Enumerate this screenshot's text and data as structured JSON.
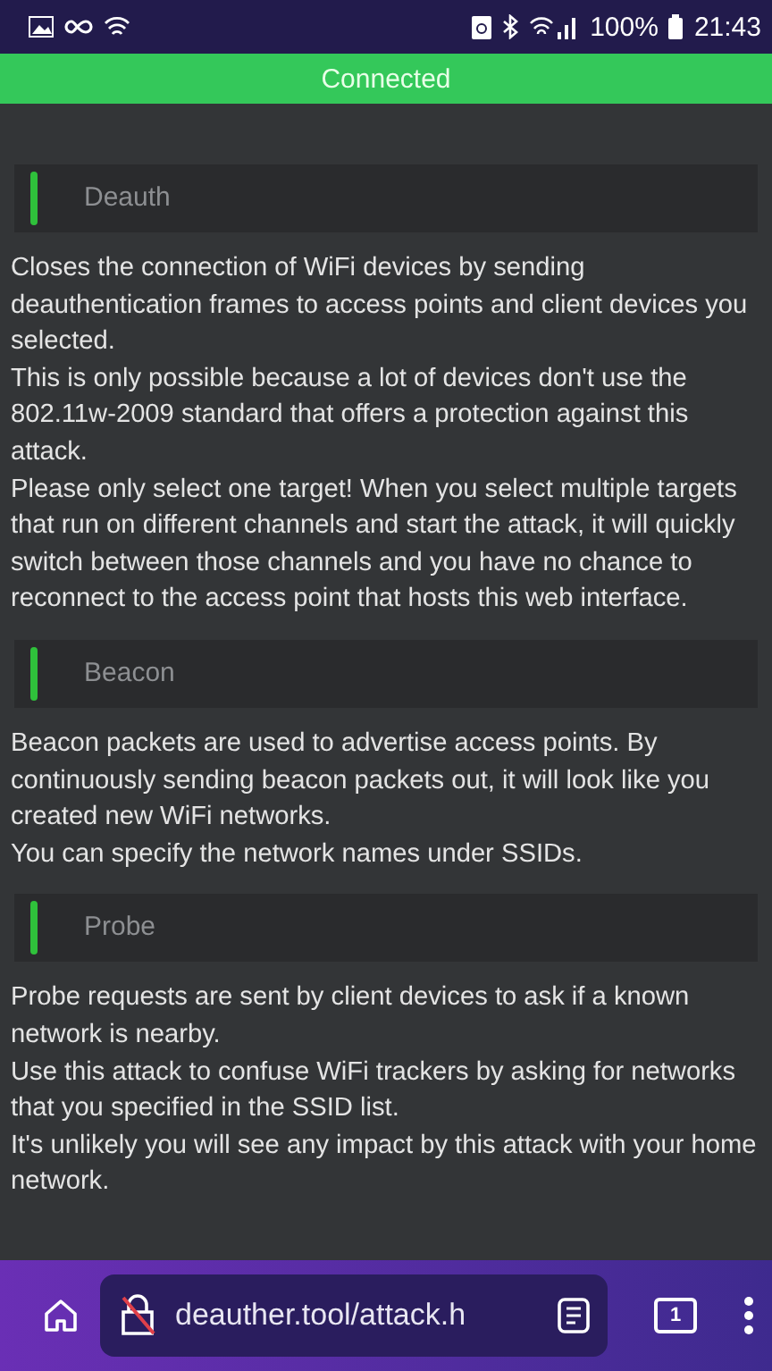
{
  "status_bar": {
    "battery": "100%",
    "time": "21:43"
  },
  "banner": {
    "text": "Connected"
  },
  "sections": [
    {
      "title": "Deauth",
      "paragraphs": [
        "Closes the connection of WiFi devices by sending deauthentication frames to access points and client devices you selected.",
        "This is only possible because a lot of devices don't use the 802.11w-2009 standard that offers a protection against this attack.",
        "Please only select one target! When you select multiple targets that run on different channels and start the attack, it will quickly switch between those channels and you have no chance to reconnect to the access point that hosts this web interface."
      ]
    },
    {
      "title": "Beacon",
      "paragraphs": [
        "Beacon packets are used to advertise access points. By continuously sending beacon packets out, it will look like you created new WiFi networks.",
        "You can specify the network names under SSIDs."
      ]
    },
    {
      "title": "Probe",
      "paragraphs": [
        "Probe requests are sent by client devices to ask if a known network is nearby.",
        "Use this attack to confuse WiFi trackers by asking for networks that you specified in the SSID list.",
        "It's unlikely you will see any impact by this attack with your home network."
      ]
    }
  ],
  "browser_bar": {
    "url": "deauther.tool/attack.h",
    "tab_count": "1"
  }
}
